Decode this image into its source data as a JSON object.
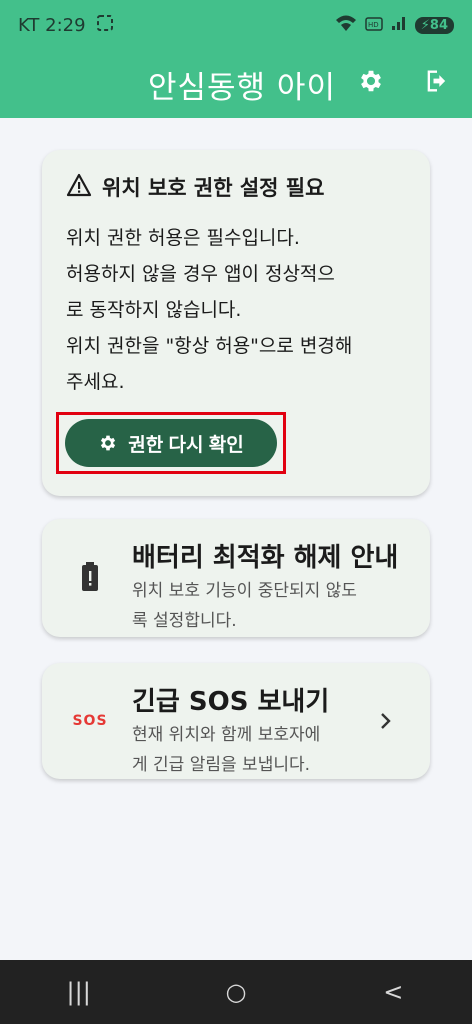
{
  "status_bar": {
    "carrier_time": "KT 2:29",
    "battery": "84"
  },
  "app_bar": {
    "title": "안심동행 아이",
    "icons": [
      "settings-icon",
      "logout-icon"
    ]
  },
  "permission_card": {
    "title": "위치 보호 권한 설정 필요",
    "lines": [
      "위치 권한 허용은 필수입니다.",
      "허용하지 않을 경우 앱이 정상적으",
      "로 동작하지 않습니다.",
      "위치 권한을 \"항상 허용\"으로 변경해",
      "주세요."
    ],
    "button_label": "권한 다시 확인"
  },
  "battery_card": {
    "title": "배터리 최적화 해제 안내",
    "subtitle_lines": [
      "위치 보호 기능이 중단되지 않도",
      "록 설정합니다."
    ]
  },
  "sos_card": {
    "icon_text": "SOS",
    "title": "긴급 SOS 보내기",
    "subtitle_lines": [
      "현재 위치와 함께 보호자에",
      "게 긴급 알림을 보냅니다."
    ]
  },
  "nav_bar": {
    "recent_label": "|||",
    "home_label": "○",
    "back_label": "<"
  },
  "colors": {
    "primary": "#43c08b",
    "button": "#276347",
    "highlight": "#e10010",
    "sos": "#e53935"
  }
}
